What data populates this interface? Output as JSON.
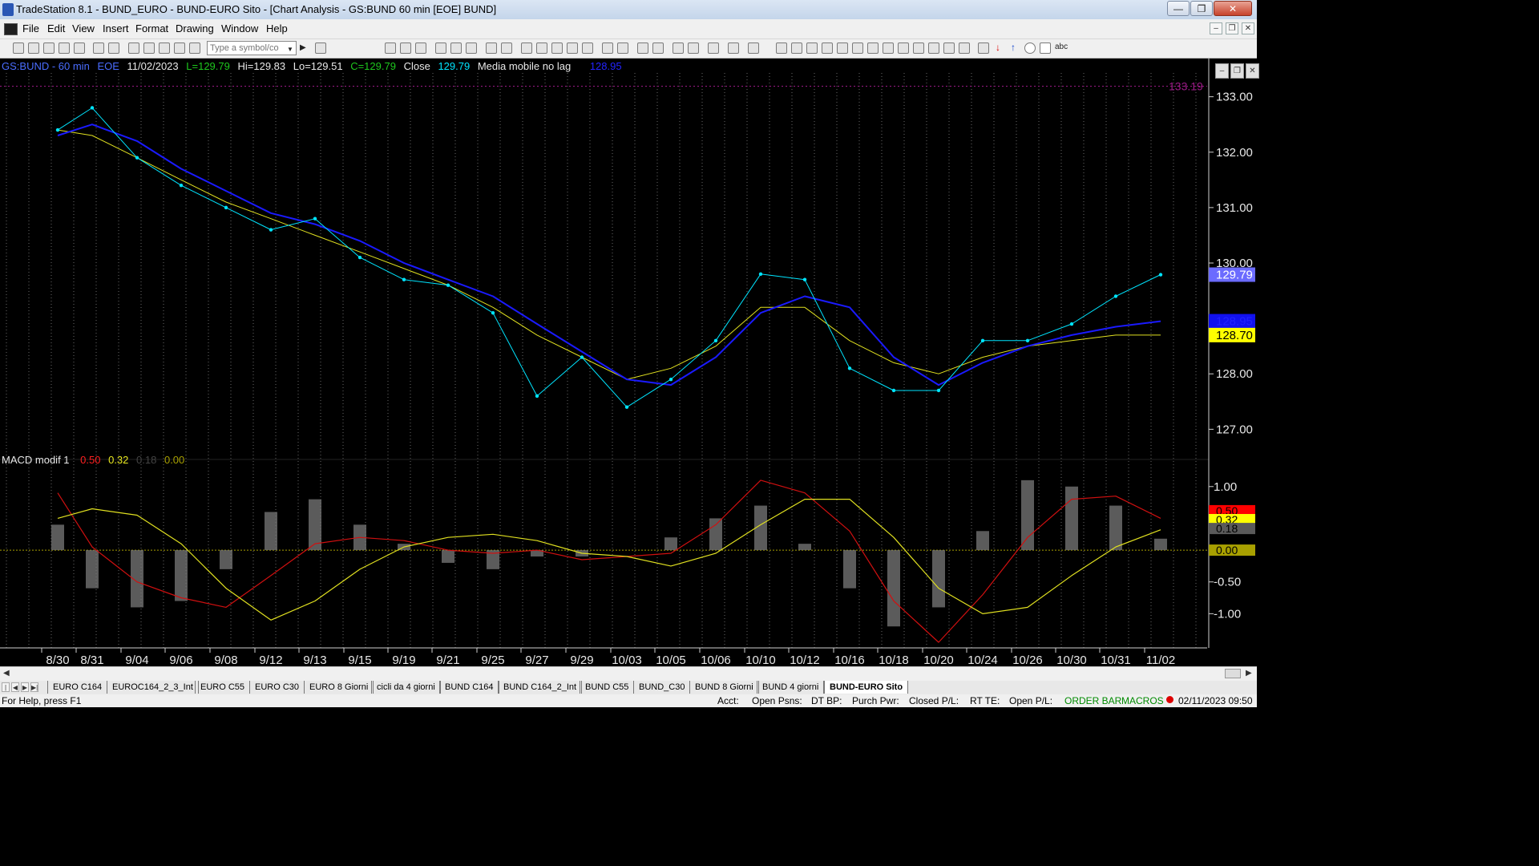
{
  "window": {
    "title": "TradeStation 8.1 - BUND_EURO - BUND-EURO Sito - [Chart Analysis - GS:BUND  60 min  [EOE] BUND]",
    "minimize_glyph": "—",
    "maximize_glyph": "❐",
    "close_glyph": "✕"
  },
  "menu": [
    "File",
    "Edit",
    "View",
    "Insert",
    "Format",
    "Drawing",
    "Window",
    "Help"
  ],
  "mdi_controls": [
    "–",
    "❐",
    "✕"
  ],
  "toolbar": {
    "symbol_placeholder": "Type a symbol/co",
    "label_abc": "abc"
  },
  "chart_header": {
    "symbol": "GS:BUND - 60 min",
    "session": "EOE",
    "date": "11/02/2023",
    "low_open": "L=129.79",
    "high": "Hi=129.83",
    "low": "Lo=129.51",
    "close_val": "C=129.79",
    "close_label": "Close",
    "close_value": "129.79",
    "indicator_name": "Media mobile no lag",
    "indicator_value": "128.95"
  },
  "price_axis": {
    "ticks": [
      "133.00",
      "132.00",
      "131.00",
      "130.00",
      "128.00",
      "127.00"
    ],
    "high_marker": "133.19",
    "last_price": "129.79",
    "ma_blue_tag": "128.95",
    "ma_yellow_tag": "128.70"
  },
  "macd": {
    "name": "MACD modif 1",
    "value_red": "0.50",
    "value_yellow": "0.32",
    "value_hist": "0.18",
    "value_zero": "0.00",
    "axis_ticks": [
      "1.00",
      "-0.50",
      "-1.00"
    ],
    "tag_red": "0.50",
    "tag_yellow": "0.32",
    "tag_hist": "0.18",
    "tag_zero": "0.00"
  },
  "x_axis_labels": [
    "8/30",
    "8/31",
    "9/04",
    "9/06",
    "9/08",
    "9/12",
    "9/13",
    "9/15",
    "9/19",
    "9/21",
    "9/25",
    "9/27",
    "9/29",
    "10/03",
    "10/05",
    "10/06",
    "10/10",
    "10/12",
    "10/16",
    "10/18",
    "10/20",
    "10/24",
    "10/26",
    "10/30",
    "10/31",
    "11/02"
  ],
  "tabs": [
    "EURO C164",
    "EUROC164_2_3_Int",
    "EURO C55",
    "EURO C30",
    "EURO 8 Giorni",
    "cicli da 4 giorni",
    "BUND C164",
    "BUND C164_2_Int",
    "BUND C55",
    "BUND_C30",
    "BUND 8 Giorni",
    "BUND 4 giorni",
    "BUND-EURO Sito"
  ],
  "active_tab": "BUND-EURO Sito",
  "status": {
    "help": "For Help, press F1",
    "acct": "Acct:",
    "open_psns": "Open Psns:",
    "dt_bp": "DT BP:",
    "purch_pwr": "Purch Pwr:",
    "closed_pl": "Closed P/L:",
    "rt_te": "RT TE:",
    "open_pl": "Open P/L:",
    "order_bar": "ORDER BAR",
    "macros": "MACROS",
    "datetime": "02/11/2023 09:50"
  },
  "colors": {
    "price_dots": "#00e5ff",
    "ma_blue": "#1a1aff",
    "ma_yellow": "#e0e020",
    "macd_red": "#d01010",
    "macd_yellow": "#e0e020",
    "histogram": "#7a7a7a",
    "high_marker": "#9b1b86",
    "status_green": "#008a00"
  },
  "chart_data": {
    "type": "line",
    "title": "GS:BUND - 60 min",
    "categories": [
      "8/30",
      "8/31",
      "9/04",
      "9/06",
      "9/08",
      "9/12",
      "9/13",
      "9/15",
      "9/19",
      "9/21",
      "9/25",
      "9/27",
      "9/29",
      "10/03",
      "10/05",
      "10/06",
      "10/10",
      "10/12",
      "10/16",
      "10/18",
      "10/20",
      "10/24",
      "10/26",
      "10/30",
      "10/31",
      "11/02"
    ],
    "ylim": [
      126.6,
      133.4
    ],
    "series": [
      {
        "name": "Close",
        "values": [
          132.4,
          132.8,
          131.9,
          131.4,
          131.0,
          130.6,
          130.8,
          130.1,
          129.7,
          129.6,
          129.1,
          127.6,
          128.3,
          127.4,
          127.9,
          128.6,
          129.8,
          129.7,
          128.1,
          127.7,
          127.7,
          128.6,
          128.6,
          128.9,
          129.4,
          129.79
        ]
      },
      {
        "name": "Media mobile no lag",
        "values": [
          132.3,
          132.5,
          132.2,
          131.7,
          131.3,
          130.9,
          130.7,
          130.4,
          130.0,
          129.7,
          129.4,
          128.9,
          128.4,
          127.9,
          127.8,
          128.3,
          129.1,
          129.4,
          129.2,
          128.3,
          127.8,
          128.2,
          128.5,
          128.7,
          128.85,
          128.95
        ]
      },
      {
        "values": [
          132.4,
          132.3,
          131.9,
          131.5,
          131.1,
          130.8,
          130.5,
          130.2,
          129.9,
          129.6,
          129.2,
          128.7,
          128.3,
          127.9,
          128.1,
          128.5,
          129.2,
          129.2,
          128.6,
          128.2,
          128.0,
          128.3,
          128.5,
          128.6,
          128.7,
          128.7
        ]
      }
    ],
    "macd": {
      "ylim": [
        -1.5,
        1.3
      ],
      "red": [
        0.9,
        0.05,
        -0.5,
        -0.75,
        -0.9,
        -0.4,
        0.1,
        0.2,
        0.15,
        0.0,
        -0.05,
        0.0,
        -0.15,
        -0.1,
        -0.05,
        0.4,
        1.1,
        0.9,
        0.3,
        -0.8,
        -1.45,
        -0.7,
        0.2,
        0.8,
        0.85,
        0.5
      ],
      "yellow": [
        0.5,
        0.65,
        0.55,
        0.1,
        -0.6,
        -1.1,
        -0.8,
        -0.3,
        0.05,
        0.2,
        0.25,
        0.15,
        -0.05,
        -0.1,
        -0.25,
        -0.05,
        0.4,
        0.8,
        0.8,
        0.2,
        -0.6,
        -1.0,
        -0.9,
        -0.4,
        0.05,
        0.32
      ],
      "histogram": [
        0.4,
        -0.6,
        -0.9,
        -0.8,
        -0.3,
        0.6,
        0.8,
        0.4,
        0.1,
        -0.2,
        -0.3,
        -0.1,
        -0.1,
        0.0,
        0.2,
        0.5,
        0.7,
        0.1,
        -0.6,
        -1.2,
        -0.9,
        0.3,
        1.1,
        1.0,
        0.7,
        0.18
      ]
    }
  }
}
